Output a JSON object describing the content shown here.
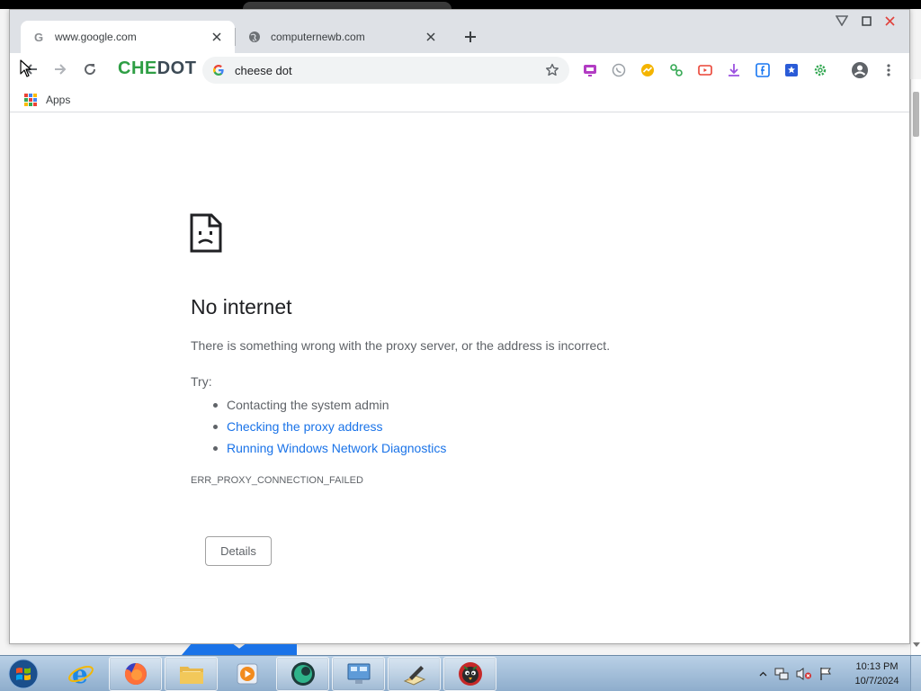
{
  "browser": {
    "tabs": [
      {
        "title": "www.google.com",
        "active": true
      },
      {
        "title": "computernewb.com",
        "active": false
      }
    ],
    "brand": {
      "part1": "CHE",
      "part2": "DOT"
    },
    "omnibox": {
      "text": "cheese dot"
    },
    "bookmarks": {
      "apps_label": "Apps"
    },
    "extensions": [
      "screen-icon",
      "whatsapp-icon",
      "messenger-icon",
      "link-icon",
      "video-icon",
      "download-icon",
      "facebook-icon",
      "vk-icon",
      "settings-gear-icon"
    ]
  },
  "error_page": {
    "title": "No internet",
    "message": "There is something wrong with the proxy server, or the address is incorrect.",
    "try_label": "Try:",
    "suggestions": [
      "Contacting the system admin",
      "Checking the proxy address",
      "Running Windows Network Diagnostics"
    ],
    "error_code": "ERR_PROXY_CONNECTION_FAILED",
    "details_button": "Details"
  },
  "taskbar": {
    "time": "10:13 PM",
    "date": "10/7/2024"
  },
  "colors": {
    "link": "#1a73e8",
    "brand_green": "#2e9e44",
    "text_secondary": "#5f6368"
  }
}
